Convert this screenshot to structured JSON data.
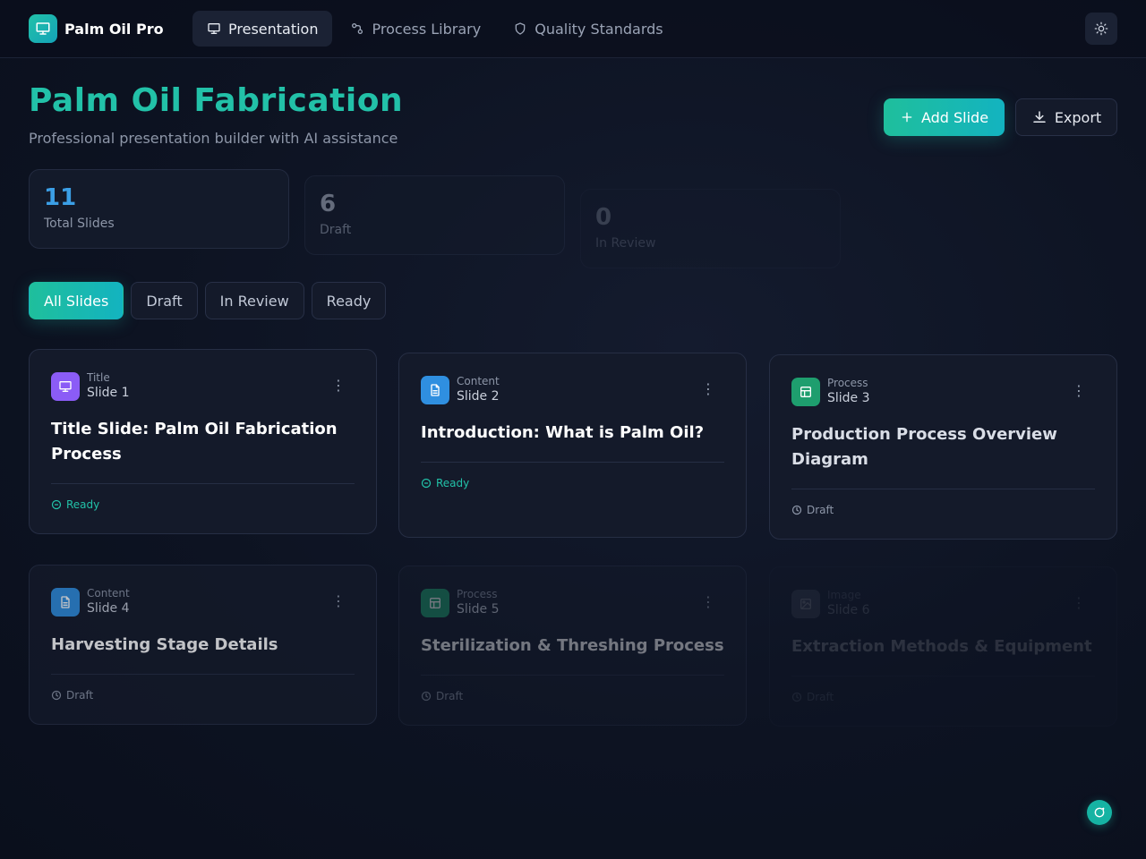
{
  "app": {
    "name": "Palm Oil Pro"
  },
  "nav": {
    "items": [
      {
        "label": "Presentation",
        "icon": "presentation-icon",
        "active": true
      },
      {
        "label": "Process Library",
        "icon": "process-icon",
        "active": false
      },
      {
        "label": "Quality Standards",
        "icon": "shield-icon",
        "active": false
      }
    ]
  },
  "header": {
    "title": "Palm Oil Fabrication",
    "subtitle": "Professional presentation builder with AI assistance",
    "add_label": "Add Slide",
    "export_label": "Export"
  },
  "stats": [
    {
      "value": "11",
      "label": "Total Slides",
      "color": "#3b9fe6"
    },
    {
      "value": "6",
      "label": "Draft",
      "color": "#8d96a8"
    },
    {
      "value": "0",
      "label": "In Review",
      "color": "#8d96a8"
    }
  ],
  "filters": [
    {
      "label": "All Slides",
      "active": true
    },
    {
      "label": "Draft",
      "active": false
    },
    {
      "label": "In Review",
      "active": false
    },
    {
      "label": "Ready",
      "active": false
    }
  ],
  "slides": [
    {
      "type": "Title",
      "number": "Slide 1",
      "title": "Title Slide: Palm Oil Fabrication Process",
      "status": "Ready",
      "icon_color": "#8b5cf6"
    },
    {
      "type": "Content",
      "number": "Slide 2",
      "title": "Introduction: What is Palm Oil?",
      "status": "Ready",
      "icon_color": "#2f8fe0"
    },
    {
      "type": "Process",
      "number": "Slide 3",
      "title": "Production Process Overview Diagram",
      "status": "Draft",
      "icon_color": "#1e9e6e"
    },
    {
      "type": "Content",
      "number": "Slide 4",
      "title": "Harvesting Stage Details",
      "status": "Draft",
      "icon_color": "#2f8fe0"
    },
    {
      "type": "Process",
      "number": "Slide 5",
      "title": "Sterilization & Threshing Process",
      "status": "Draft",
      "icon_color": "#1e9e6e"
    },
    {
      "type": "Image",
      "number": "Slide 6",
      "title": "Extraction Methods & Equipment",
      "status": "Draft",
      "icon_color": "#6b7280"
    }
  ]
}
